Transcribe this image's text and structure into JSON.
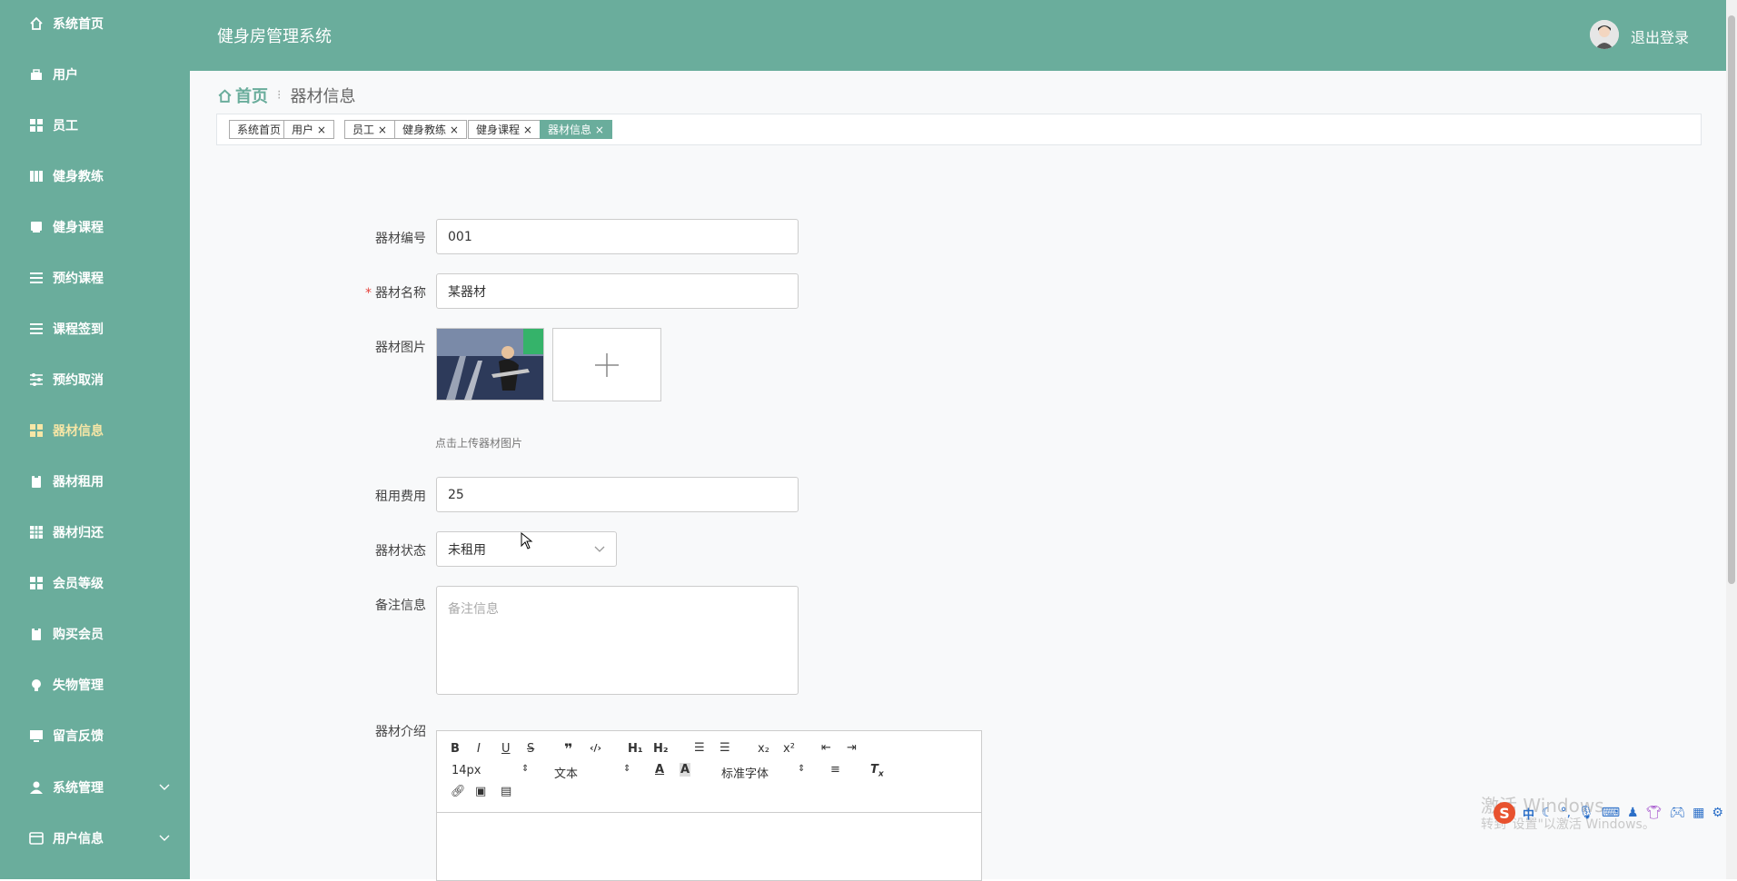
{
  "app": {
    "title": "健身房管理系统",
    "logout": "退出登录"
  },
  "sidebar": {
    "items": [
      {
        "label": "系统首页",
        "icon": "home-icon"
      },
      {
        "label": "用户",
        "icon": "user-group-icon"
      },
      {
        "label": "员工",
        "icon": "grid-icon"
      },
      {
        "label": "健身教练",
        "icon": "columns-icon"
      },
      {
        "label": "健身课程",
        "icon": "book-icon"
      },
      {
        "label": "预约课程",
        "icon": "list-icon"
      },
      {
        "label": "课程签到",
        "icon": "list-icon"
      },
      {
        "label": "预约取消",
        "icon": "sliders-icon"
      },
      {
        "label": "器材信息",
        "icon": "grid-icon",
        "active": true
      },
      {
        "label": "器材租用",
        "icon": "clipboard-icon"
      },
      {
        "label": "器材归还",
        "icon": "table-icon"
      },
      {
        "label": "会员等级",
        "icon": "grid-icon"
      },
      {
        "label": "购买会员",
        "icon": "clipboard-icon"
      },
      {
        "label": "失物管理",
        "icon": "bulb-icon"
      },
      {
        "label": "留言反馈",
        "icon": "monitor-icon"
      },
      {
        "label": "系统管理",
        "icon": "person-icon",
        "expandable": true
      },
      {
        "label": "用户信息",
        "icon": "card-icon",
        "expandable": true
      }
    ]
  },
  "breadcrumb": {
    "home": "首页",
    "current": "器材信息"
  },
  "tabs": [
    {
      "label": "系统首页",
      "closable": false
    },
    {
      "label": "用户",
      "closable": true
    },
    {
      "label": "员工",
      "closable": true
    },
    {
      "label": "健身教练",
      "closable": true
    },
    {
      "label": "健身课程",
      "closable": true
    },
    {
      "label": "器材信息",
      "closable": true,
      "active": true
    }
  ],
  "form": {
    "code": {
      "label": "器材编号",
      "value": "001"
    },
    "name": {
      "label": "器材名称",
      "value": "某器材",
      "required": true
    },
    "image": {
      "label": "器材图片",
      "hint": "点击上传器材图片"
    },
    "fee": {
      "label": "租用费用",
      "value": "25"
    },
    "status": {
      "label": "器材状态",
      "value": "未租用"
    },
    "remark": {
      "label": "备注信息",
      "placeholder": "备注信息"
    },
    "intro": {
      "label": "器材介绍"
    }
  },
  "editor": {
    "fontsize": "14px",
    "header": "文本",
    "font": "标准字体"
  },
  "watermark": {
    "line1": "激活 Windows",
    "line2": "转到\"设置\"以激活 Windows。"
  },
  "colors": {
    "accent": "#6aad9c",
    "active_nav": "#f7e6a6",
    "required": "#e5443d"
  }
}
